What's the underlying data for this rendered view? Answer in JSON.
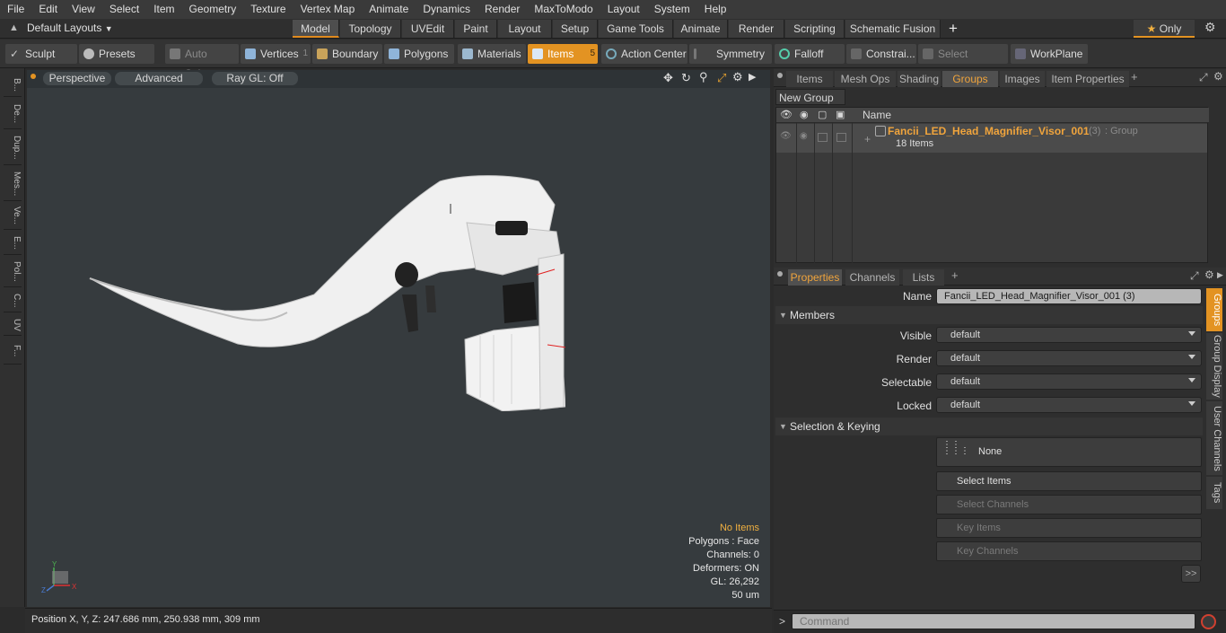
{
  "menu": [
    "File",
    "Edit",
    "View",
    "Select",
    "Item",
    "Geometry",
    "Texture",
    "Vertex Map",
    "Animate",
    "Dynamics",
    "Render",
    "MaxToModo",
    "Layout",
    "System",
    "Help"
  ],
  "layout": {
    "default_layouts": "Default Layouts",
    "tabs": [
      "Model",
      "Topology",
      "UVEdit",
      "Paint",
      "Layout",
      "Setup",
      "Game Tools",
      "Animate",
      "Render",
      "Scripting",
      "Schematic Fusion"
    ],
    "add": "+",
    "only": "Only"
  },
  "toolbar": {
    "sculpt": "Sculpt",
    "presets": "Presets",
    "auto_select": "Auto Select",
    "vertices": "Vertices",
    "vertices_count": "1",
    "boundary": "Boundary",
    "polygons": "Polygons",
    "materials": "Materials",
    "items": "Items",
    "items_count": "5",
    "action_center": "Action Center",
    "symmetry": "Symmetry",
    "falloff": "Falloff",
    "constraints": "Constrai...",
    "select_through": "Select Through",
    "workplane": "WorkPlane"
  },
  "left_tabs": [
    "B...",
    "De...",
    "Dup...",
    "Mes...",
    "Ve...",
    "E...",
    "Pol...",
    "C...",
    "UV",
    "F..."
  ],
  "viewport": {
    "perspective": "Perspective",
    "advanced": "Advanced",
    "raygl": "Ray GL: Off",
    "info_items": "No Items",
    "info_polygons": "Polygons : Face",
    "info_channels": "Channels: 0",
    "info_deformers": "Deformers: ON",
    "info_gl": "GL: 26,292",
    "info_scale": "50 um",
    "axis_y": "Y",
    "axis_x": "X",
    "axis_z": "Z"
  },
  "status": {
    "position": "Position X, Y, Z:  247.686 mm, 250.938 mm, 309 mm"
  },
  "top_tabs": [
    "Items",
    "Mesh Ops",
    "Shading",
    "Groups",
    "Images",
    "Item Properties"
  ],
  "top_tabs_active": "Groups",
  "groups": {
    "new_group": "New Group",
    "col_name": "Name",
    "item_name": "Fancii_LED_Head_Magnifier_Visor_001",
    "item_count": "(3)",
    "item_type": ": Group",
    "item_sub": "18 Items"
  },
  "bottom_tabs": [
    "Properties",
    "Channels",
    "Lists"
  ],
  "props": {
    "name_label": "Name",
    "name_value": "Fancii_LED_Head_Magnifier_Visor_001 (3)",
    "members": "Members",
    "visible_label": "Visible",
    "visible_value": "default",
    "render_label": "Render",
    "render_value": "default",
    "selectable_label": "Selectable",
    "selectable_value": "default",
    "locked_label": "Locked",
    "locked_value": "default",
    "selection_keying": "Selection & Keying",
    "none": "None",
    "select_items": "Select Items",
    "select_channels": "Select Channels",
    "key_items": "Key Items",
    "key_channels": "Key Channels",
    "more": ">>"
  },
  "side_tabs": [
    "Groups",
    "Group Display",
    "User Channels",
    "Tags"
  ],
  "command": {
    "prompt": ">",
    "placeholder": "Command"
  },
  "colors": {
    "accent": "#e39322",
    "group_name": "#f0a43c"
  }
}
